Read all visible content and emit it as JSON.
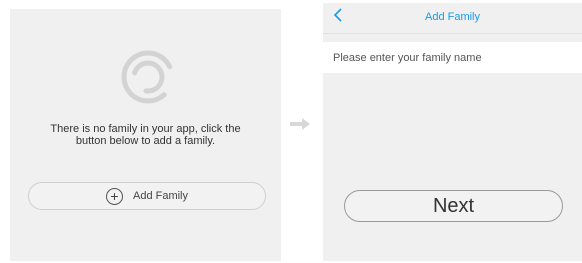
{
  "left_screen": {
    "empty_message": "There is no family in your app, click the button below to add a family.",
    "add_button": {
      "label": "Add Family",
      "icon": "plus-circle-icon"
    },
    "logo_icon": "app-logo-icon"
  },
  "flow_arrow_icon": "arrow-right-icon",
  "right_screen": {
    "nav": {
      "title": "Add Family",
      "back_icon": "chevron-left-icon"
    },
    "name_input": {
      "placeholder": "Please enter your family name",
      "value": ""
    },
    "next_button": {
      "label": "Next"
    }
  },
  "colors": {
    "accent": "#1a9be6",
    "panel_bg": "#f0f0f0",
    "logo": "#d5d5d5"
  }
}
